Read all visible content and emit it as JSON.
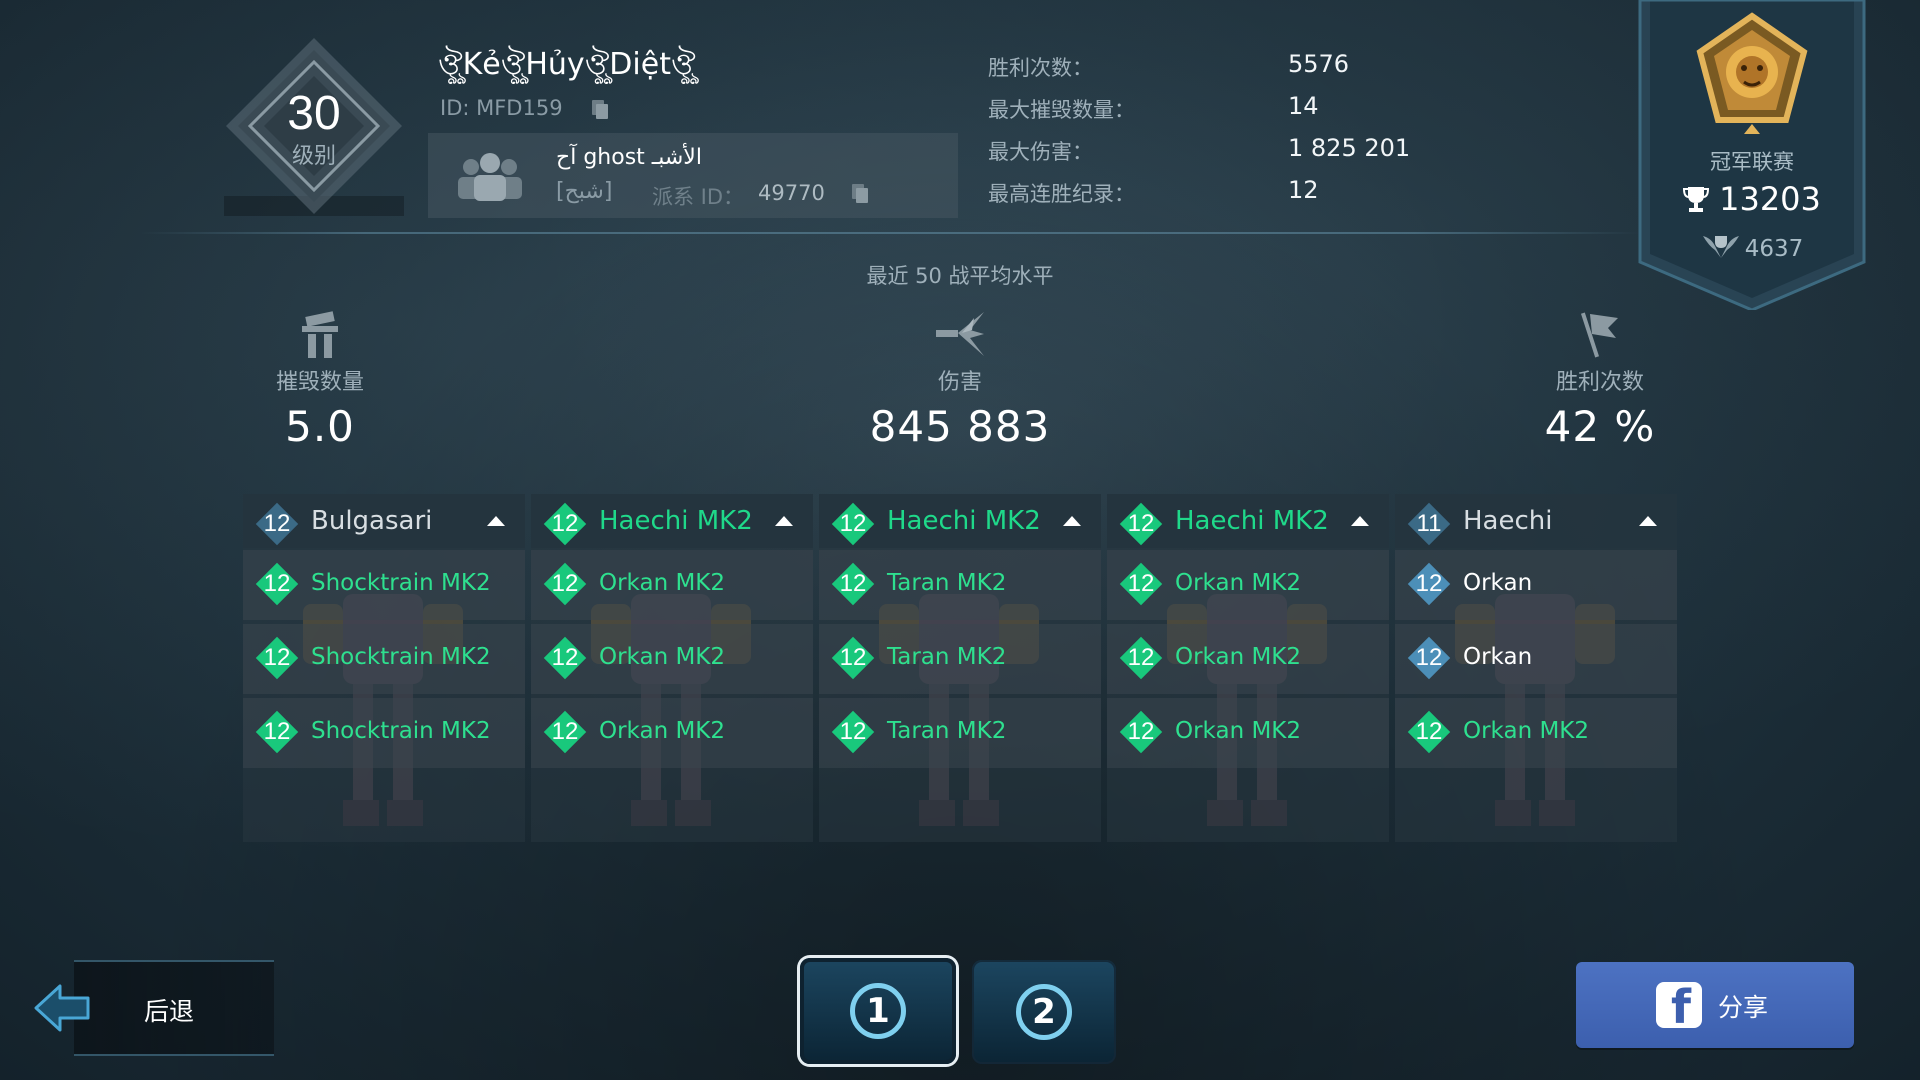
{
  "player": {
    "level": "30",
    "level_label": "级别",
    "name": "ঔৣKẻঔৣHủyঔৣDiệtঔৣ",
    "id_text": "ID: MFD159"
  },
  "clan": {
    "name": "آح ghost الأشبـ",
    "tag": "[شبح]",
    "id_label": "派系 ID：",
    "id_value": "49770"
  },
  "stats": [
    {
      "label": "胜利次数：",
      "value": "5576"
    },
    {
      "label": "最大摧毁数量：",
      "value": "14"
    },
    {
      "label": "最大伤害：",
      "value": "1 825 201"
    },
    {
      "label": "最高连胜纪录：",
      "value": "12"
    }
  ],
  "league": {
    "name": "冠军联赛",
    "trophies": "13203",
    "rank": "4637"
  },
  "averages": {
    "title": "最近 50 战平均水平",
    "kills_label": "摧毁数量",
    "kills_value": "5.0",
    "damage_label": "伤害",
    "damage_value": "845 883",
    "wins_label": "胜利次数",
    "wins_value": "42 %"
  },
  "colors": {
    "green": "#19c87c",
    "blue_level": "#4c8fb8",
    "robot_white": "#d8dee2",
    "robot_green": "#1fd98a",
    "weapon_green": "#2ee08f",
    "weapon_white": "#ffffff"
  },
  "robots": [
    {
      "name": "Bulgasari",
      "level": "12",
      "style": "white",
      "weapons": [
        {
          "name": "Shocktrain MK2",
          "level": "12",
          "style": "green"
        },
        {
          "name": "Shocktrain MK2",
          "level": "12",
          "style": "green"
        },
        {
          "name": "Shocktrain MK2",
          "level": "12",
          "style": "green"
        }
      ]
    },
    {
      "name": "Haechi MK2",
      "level": "12",
      "style": "green",
      "weapons": [
        {
          "name": "Orkan MK2",
          "level": "12",
          "style": "green"
        },
        {
          "name": "Orkan MK2",
          "level": "12",
          "style": "green"
        },
        {
          "name": "Orkan MK2",
          "level": "12",
          "style": "green"
        }
      ]
    },
    {
      "name": "Haechi MK2",
      "level": "12",
      "style": "green",
      "weapons": [
        {
          "name": "Taran MK2",
          "level": "12",
          "style": "green"
        },
        {
          "name": "Taran MK2",
          "level": "12",
          "style": "green"
        },
        {
          "name": "Taran MK2",
          "level": "12",
          "style": "green"
        }
      ]
    },
    {
      "name": "Haechi MK2",
      "level": "12",
      "style": "green",
      "weapons": [
        {
          "name": "Orkan MK2",
          "level": "12",
          "style": "green"
        },
        {
          "name": "Orkan MK2",
          "level": "12",
          "style": "green"
        },
        {
          "name": "Orkan MK2",
          "level": "12",
          "style": "green"
        }
      ]
    },
    {
      "name": "Haechi",
      "level": "11",
      "style": "white",
      "weapons": [
        {
          "name": "Orkan",
          "level": "12",
          "style": "blue"
        },
        {
          "name": "Orkan",
          "level": "12",
          "style": "blue"
        },
        {
          "name": "Orkan MK2",
          "level": "12",
          "style": "green"
        }
      ]
    }
  ],
  "bottom": {
    "back_label": "后退",
    "page_1": "1",
    "page_2": "2",
    "share_label": "分享",
    "fb_glyph": "f"
  },
  "icons": {
    "copy": "copy-icon",
    "clan": "clan-members-icon",
    "trophy": "trophy-icon",
    "league_emblem": "lion-emblem-icon",
    "kills": "destroyed-robot-icon",
    "damage": "damage-blast-icon",
    "wins": "victory-flag-icon",
    "back": "back-arrow-icon",
    "facebook": "facebook-icon"
  }
}
